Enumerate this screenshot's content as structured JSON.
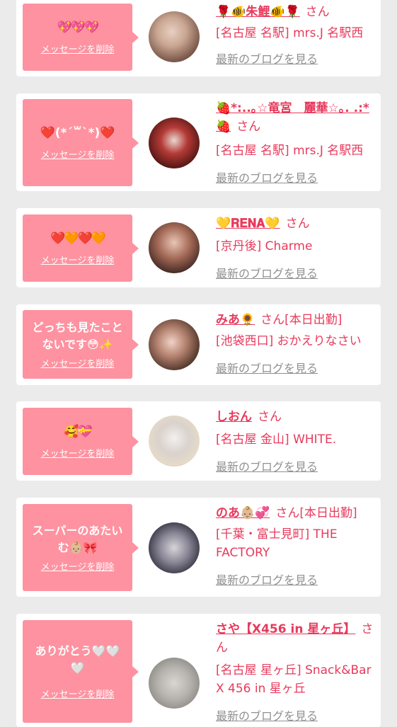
{
  "messages": [
    {
      "text": "💖💖💖",
      "delete_label": "メッセージを削除",
      "name": "🌹🐠朱鯉🐠🌹",
      "honorific": "さん",
      "status": "",
      "shop": "[名古屋 名駅] mrs.J 名駅西",
      "blog_label": "最新のブログを見る"
    },
    {
      "text": "❤️(*´꒳`*)❤️",
      "delete_label": "メッセージを削除",
      "name": "🍓*:..｡☆竜宮　麗華☆｡. .:*🍓",
      "honorific": "さん",
      "status": "",
      "shop": "[名古屋 名駅] mrs.J 名駅西",
      "blog_label": "最新のブログを見る"
    },
    {
      "text": "❤️🧡❤️🧡",
      "delete_label": "メッセージを削除",
      "name": "💛𝐑𝐄𝐍𝐀💛",
      "honorific": "さん",
      "status": "",
      "shop": "[京丹後] Charme",
      "blog_label": "最新のブログを見る"
    },
    {
      "text": "どっちも見たことないです😳✨",
      "delete_label": "メッセージを削除",
      "name": "みあ🌻",
      "honorific": "さん",
      "status": "[本日出勤]",
      "shop": "[池袋西口] おかえりなさい",
      "blog_label": "最新のブログを見る"
    },
    {
      "text": "🥰💝",
      "delete_label": "メッセージを削除",
      "name": "しおん",
      "honorific": "さん",
      "status": "",
      "shop": "[名古屋 金山] WHITE.",
      "blog_label": "最新のブログを見る"
    },
    {
      "text": "スーパーのあたいむ👶🏼🎀",
      "delete_label": "メッセージを削除",
      "name": "のあ👶🏼💞",
      "honorific": "さん",
      "status": "[本日出勤]",
      "shop": "[千葉・富士見町] THE FACTORY",
      "blog_label": "最新のブログを見る"
    },
    {
      "text": "ありがとう🤍🤍🤍",
      "delete_label": "メッセージを削除",
      "name": "さや【X456 in 星ヶ丘】",
      "honorific": "さん",
      "status": "",
      "shop": "[名古屋 星ヶ丘] Snack&Bar X 456 in 星ヶ丘",
      "blog_label": "最新のブログを見る"
    }
  ]
}
